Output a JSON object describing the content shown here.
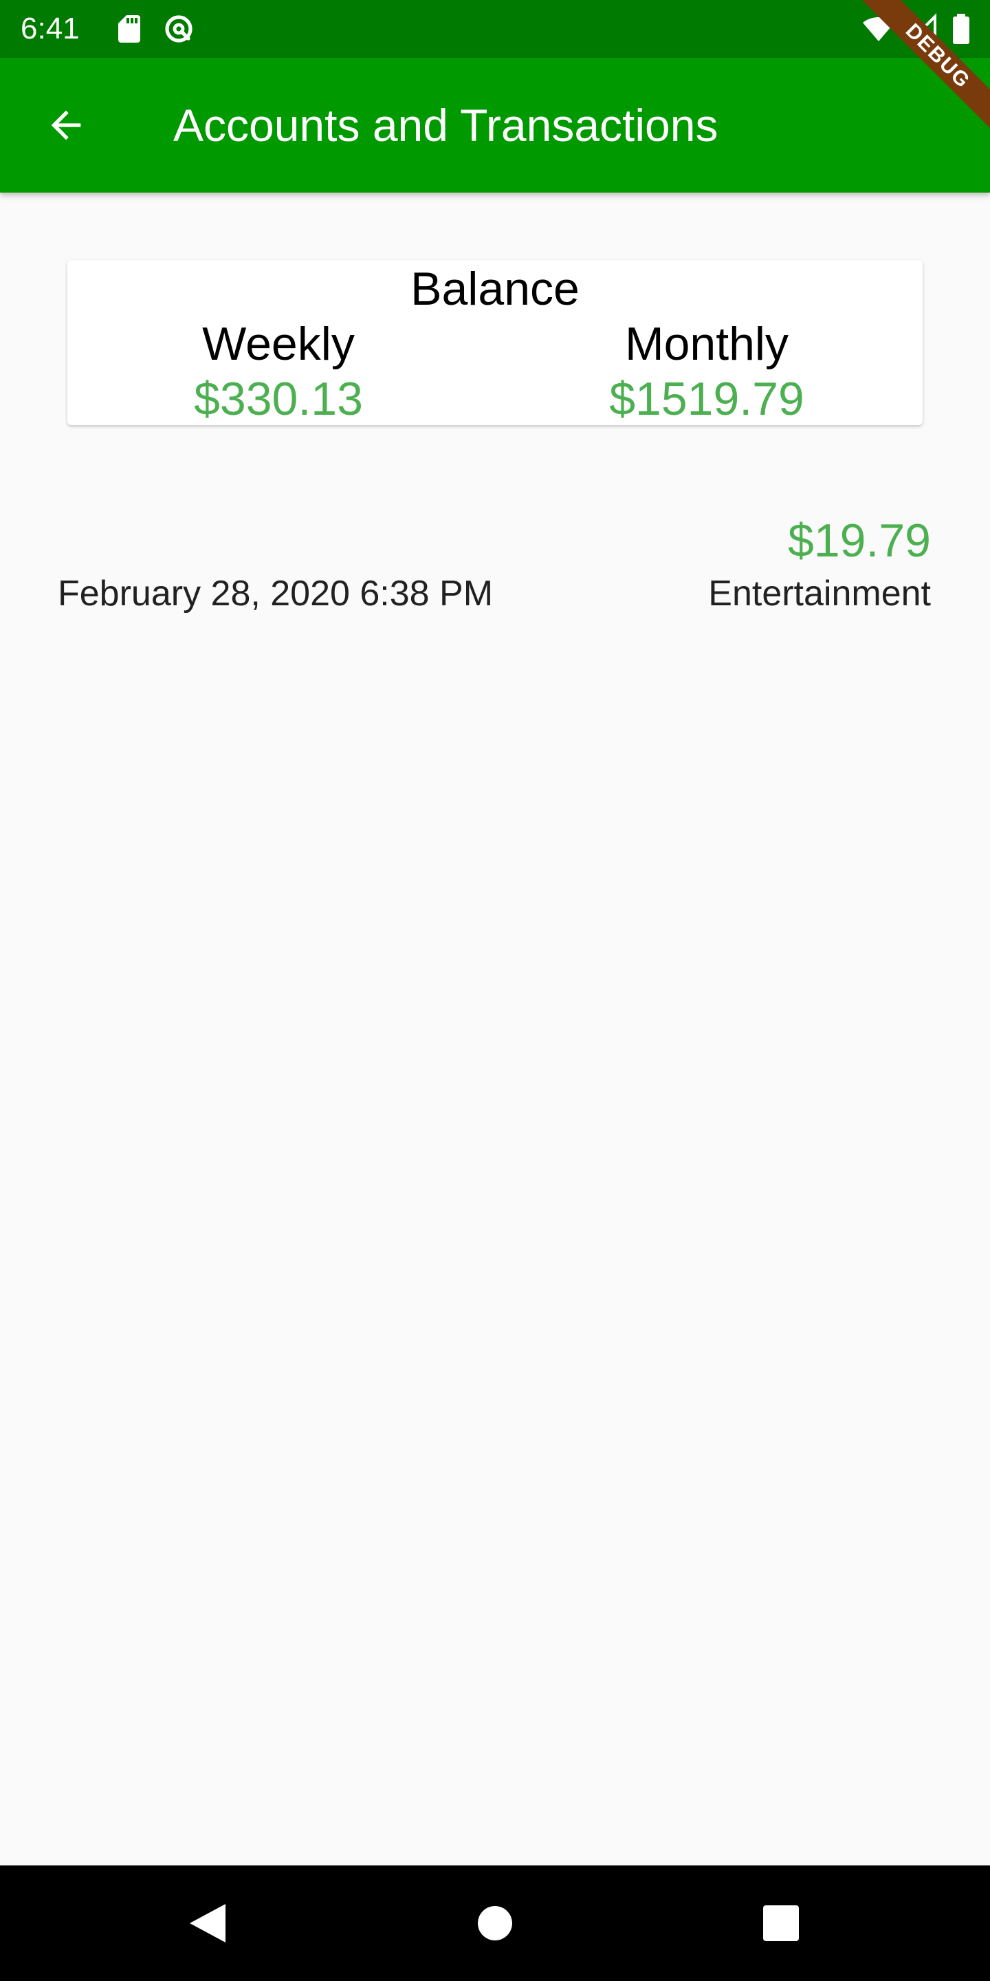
{
  "status_bar": {
    "time": "6:41",
    "left_icons": [
      "sd-card-icon",
      "sync-icon"
    ],
    "right_icons": [
      "wifi-icon",
      "signal-icon",
      "battery-icon"
    ]
  },
  "app_bar": {
    "title": "Accounts and Transactions",
    "back_icon": "arrow-back-icon",
    "color": "#009900"
  },
  "debug_banner": "DEBUG",
  "balance": {
    "title": "Balance",
    "weekly_label": "Weekly",
    "weekly_value": "$330.13",
    "monthly_label": "Monthly",
    "monthly_value": "$1519.79",
    "value_color": "#4caf50"
  },
  "transactions": [
    {
      "amount": "$19.79",
      "category": "Entertainment",
      "date": "February 28, 2020 6:38 PM"
    }
  ],
  "nav_bar": {
    "buttons": [
      "back-triangle-icon",
      "home-circle-icon",
      "recents-square-icon"
    ]
  }
}
